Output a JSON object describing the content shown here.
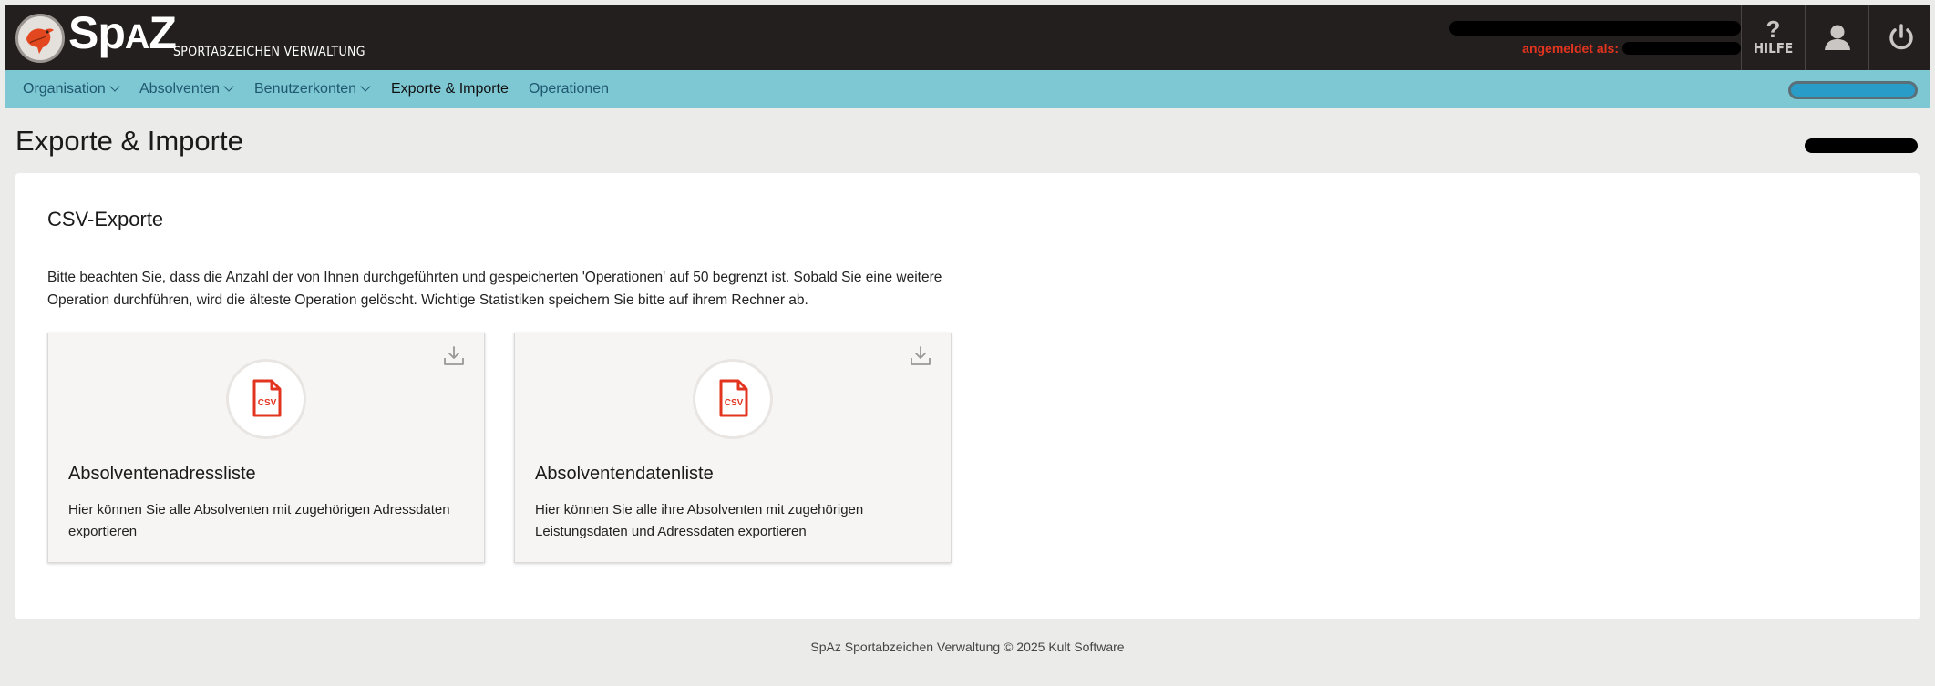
{
  "brand": {
    "logo_text_big": "Sp",
    "logo_text_small": "A",
    "logo_text_end": "Z",
    "subtitle": "SPORTABZEICHEN VERWALTUNG"
  },
  "header": {
    "user_label": "angemeldet als:",
    "help_label": "HILFE",
    "accent_color": "#e2341f"
  },
  "nav": {
    "items": [
      {
        "label": "Organisation",
        "has_dropdown": true
      },
      {
        "label": "Absolventen",
        "has_dropdown": true
      },
      {
        "label": "Benutzerkonten",
        "has_dropdown": true
      },
      {
        "label": "Exporte & Importe",
        "has_dropdown": false,
        "active": true
      },
      {
        "label": "Operationen",
        "has_dropdown": false
      }
    ]
  },
  "page": {
    "title": "Exporte & Importe"
  },
  "section": {
    "title": "CSV-Exporte",
    "notice_line1": "Bitte beachten Sie, dass die Anzahl der von Ihnen durchgeführten und gespeicherten 'Operationen' auf 50 begrenzt ist. Sobald Sie eine weitere",
    "notice_line2": "Operation durchführen, wird die älteste Operation gelöscht. Wichtige Statistiken speichern Sie bitte auf ihrem Rechner ab."
  },
  "tiles": [
    {
      "icon": "csv-file-icon",
      "title": "Absolventenadressliste",
      "desc_line1": "Hier können Sie alle Absolventen mit zugehörigen Adressdaten",
      "desc_line2": "exportieren"
    },
    {
      "icon": "csv-file-icon",
      "title": "Absolventendatenliste",
      "desc_line1": "Hier können Sie alle ihre Absolventen mit zugehörigen",
      "desc_line2": "Leistungsdaten und Adressdaten exportieren"
    }
  ],
  "footer": {
    "text": "SpAz Sportabzeichen Verwaltung © 2025 Kult Software"
  },
  "colors": {
    "header_bg": "#231f1e",
    "nav_bg": "#7ec8d3",
    "csv_icon": "#e2341f"
  }
}
